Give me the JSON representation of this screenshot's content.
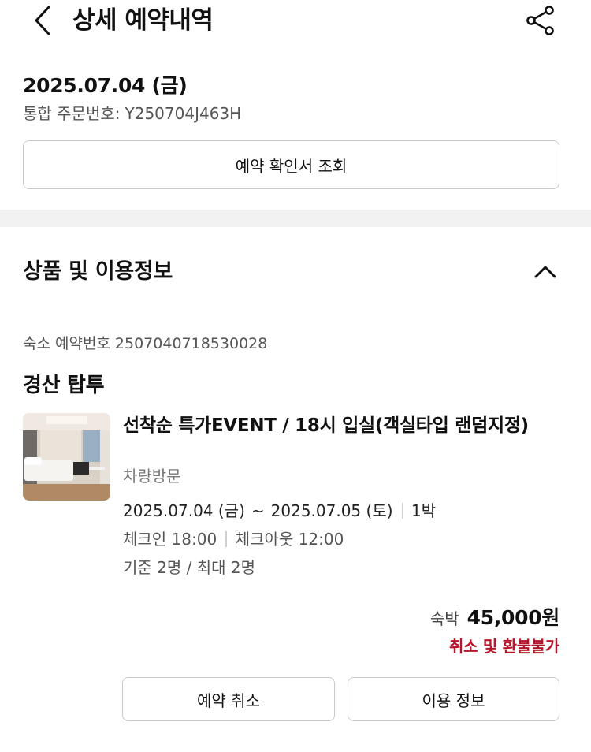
{
  "header": {
    "title": "상세 예약내역",
    "back_icon": "chevron-left-icon",
    "share_icon": "share-icon"
  },
  "order": {
    "date": "2025.07.04 (금)",
    "number_label": "통합 주문번호:",
    "number_value": "Y250704J463H",
    "confirm_button": "예약 확인서 조회"
  },
  "product_section": {
    "title": "상품 및 이용정보",
    "collapse_icon": "chevron-up-icon",
    "stay_number_label": "숙소 예약번호",
    "stay_number_value": "2507040718530028",
    "hotel_name": "경산 탑투",
    "room_name": "선착순 특가EVENT / 18시 입실(객실타입 랜덤지정)",
    "visit_type": "차량방문",
    "check_in_date": "2025.07.04 (금)",
    "date_separator": "~",
    "check_out_date": "2025.07.05 (토)",
    "nights": "1박",
    "check_in_time": "체크인 18:00",
    "check_out_time": "체크아웃 12:00",
    "occupancy": "기준 2명 / 최대 2명",
    "price_label": "숙박",
    "price": "45,000원",
    "refund_policy": "취소 및 환불불가",
    "cancel_button": "예약 취소",
    "info_button": "이용 정보"
  },
  "colors": {
    "accent_red": "#b5172a",
    "divider": "#f2f2f2",
    "border": "#c9c9c9"
  }
}
